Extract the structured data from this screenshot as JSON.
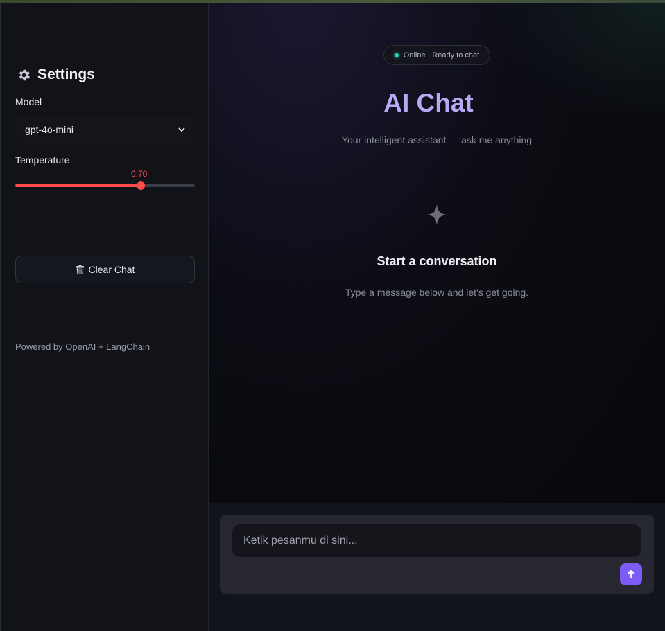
{
  "sidebar": {
    "title": "Settings",
    "model_label": "Model",
    "model_value": "gpt-4o-mini",
    "temperature_label": "Temperature",
    "temperature_value": "0.70",
    "temperature_fraction": 0.7,
    "clear_chat_label": "Clear Chat",
    "powered_by": "Powered by OpenAI + LangChain"
  },
  "main": {
    "status": "Online · Ready to chat",
    "title": "AI Chat",
    "subtitle": "Your intelligent assistant — ask me anything",
    "empty_title": "Start a conversation",
    "empty_subtitle": "Type a message below and let's get going."
  },
  "chat_input": {
    "placeholder": "Ketik pesanmu di sini..."
  },
  "colors": {
    "accent_red": "#ff4b4b",
    "accent_purple": "#7c5cf5",
    "title_lavender": "#b8a9f5",
    "status_green": "#2dd4bf"
  },
  "icons": {
    "settings": "gear-icon",
    "model_select": "chevron-down-icon",
    "clear_chat": "trash-icon",
    "empty_state": "sparkle-icon",
    "send": "arrow-up-icon"
  }
}
